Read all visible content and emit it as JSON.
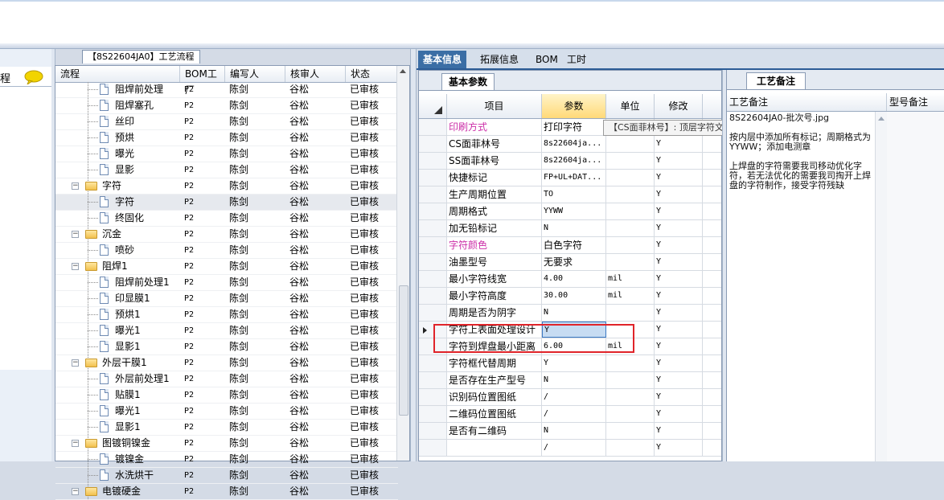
{
  "left_panel": {
    "label": "程",
    "chat_icon": "speech-bubble-icon"
  },
  "process": {
    "title": "【8S22604JA0】工艺流程",
    "columns": [
      "流程",
      "BOM工厂",
      "编写人",
      "核审人",
      "状态"
    ],
    "rows": [
      {
        "name": "阻焊前处理",
        "bom": "P2",
        "writer": "陈剑",
        "reviewer": "谷松",
        "status": "已审核",
        "level": 2,
        "kind": "doc"
      },
      {
        "name": "阻焊塞孔",
        "bom": "P2",
        "writer": "陈剑",
        "reviewer": "谷松",
        "status": "已审核",
        "level": 2,
        "kind": "doc"
      },
      {
        "name": "丝印",
        "bom": "P2",
        "writer": "陈剑",
        "reviewer": "谷松",
        "status": "已审核",
        "level": 2,
        "kind": "doc"
      },
      {
        "name": "预烘",
        "bom": "P2",
        "writer": "陈剑",
        "reviewer": "谷松",
        "status": "已审核",
        "level": 2,
        "kind": "doc"
      },
      {
        "name": "曝光",
        "bom": "P2",
        "writer": "陈剑",
        "reviewer": "谷松",
        "status": "已审核",
        "level": 2,
        "kind": "doc"
      },
      {
        "name": "显影",
        "bom": "P2",
        "writer": "陈剑",
        "reviewer": "谷松",
        "status": "已审核",
        "level": 2,
        "kind": "doc"
      },
      {
        "name": "字符",
        "bom": "P2",
        "writer": "陈剑",
        "reviewer": "谷松",
        "status": "已审核",
        "level": 1,
        "kind": "folder"
      },
      {
        "name": "字符",
        "bom": "P2",
        "writer": "陈剑",
        "reviewer": "谷松",
        "status": "已审核",
        "level": 2,
        "kind": "doc",
        "selected": true
      },
      {
        "name": "终固化",
        "bom": "P2",
        "writer": "陈剑",
        "reviewer": "谷松",
        "status": "已审核",
        "level": 2,
        "kind": "doc"
      },
      {
        "name": "沉金",
        "bom": "P2",
        "writer": "陈剑",
        "reviewer": "谷松",
        "status": "已审核",
        "level": 1,
        "kind": "folder"
      },
      {
        "name": "喷砂",
        "bom": "P2",
        "writer": "陈剑",
        "reviewer": "谷松",
        "status": "已审核",
        "level": 2,
        "kind": "doc"
      },
      {
        "name": "阻焊1",
        "bom": "P2",
        "writer": "陈剑",
        "reviewer": "谷松",
        "status": "已审核",
        "level": 1,
        "kind": "folder"
      },
      {
        "name": "阻焊前处理1",
        "bom": "P2",
        "writer": "陈剑",
        "reviewer": "谷松",
        "status": "已审核",
        "level": 2,
        "kind": "doc"
      },
      {
        "name": "印显膜1",
        "bom": "P2",
        "writer": "陈剑",
        "reviewer": "谷松",
        "status": "已审核",
        "level": 2,
        "kind": "doc"
      },
      {
        "name": "预烘1",
        "bom": "P2",
        "writer": "陈剑",
        "reviewer": "谷松",
        "status": "已审核",
        "level": 2,
        "kind": "doc"
      },
      {
        "name": "曝光1",
        "bom": "P2",
        "writer": "陈剑",
        "reviewer": "谷松",
        "status": "已审核",
        "level": 2,
        "kind": "doc"
      },
      {
        "name": "显影1",
        "bom": "P2",
        "writer": "陈剑",
        "reviewer": "谷松",
        "status": "已审核",
        "level": 2,
        "kind": "doc"
      },
      {
        "name": "外层干膜1",
        "bom": "P2",
        "writer": "陈剑",
        "reviewer": "谷松",
        "status": "已审核",
        "level": 1,
        "kind": "folder"
      },
      {
        "name": "外层前处理1",
        "bom": "P2",
        "writer": "陈剑",
        "reviewer": "谷松",
        "status": "已审核",
        "level": 2,
        "kind": "doc"
      },
      {
        "name": "贴膜1",
        "bom": "P2",
        "writer": "陈剑",
        "reviewer": "谷松",
        "status": "已审核",
        "level": 2,
        "kind": "doc"
      },
      {
        "name": "曝光1",
        "bom": "P2",
        "writer": "陈剑",
        "reviewer": "谷松",
        "status": "已审核",
        "level": 2,
        "kind": "doc"
      },
      {
        "name": "显影1",
        "bom": "P2",
        "writer": "陈剑",
        "reviewer": "谷松",
        "status": "已审核",
        "level": 2,
        "kind": "doc"
      },
      {
        "name": "图镀铜镍金",
        "bom": "P2",
        "writer": "陈剑",
        "reviewer": "谷松",
        "status": "已审核",
        "level": 1,
        "kind": "folder"
      },
      {
        "name": "镀镍金",
        "bom": "P2",
        "writer": "陈剑",
        "reviewer": "谷松",
        "status": "已审核",
        "level": 2,
        "kind": "doc"
      },
      {
        "name": "水洗烘干",
        "bom": "P2",
        "writer": "陈剑",
        "reviewer": "谷松",
        "status": "已审核",
        "level": 2,
        "kind": "doc"
      },
      {
        "name": "电镀硬金",
        "bom": "P2",
        "writer": "陈剑",
        "reviewer": "谷松",
        "status": "已审核",
        "level": 1,
        "kind": "folder"
      }
    ]
  },
  "tabs": [
    {
      "label": "基本信息",
      "active": true
    },
    {
      "label": "拓展信息",
      "active": false
    },
    {
      "label": "BOM",
      "active": false
    },
    {
      "label": "工时",
      "active": false
    }
  ],
  "params": {
    "tab_label": "基本参数",
    "columns": [
      "项目",
      "参数",
      "单位",
      "修改"
    ],
    "tooltip": "【CS面菲林号】: 顶层字符文件名",
    "rows": [
      {
        "item": "印刷方式",
        "value": "打印字符",
        "unit": "",
        "mod": "",
        "pink": true
      },
      {
        "item": "CS面菲林号",
        "value": "8s22604ja...",
        "unit": "",
        "mod": "Y",
        "mono": true
      },
      {
        "item": "SS面菲林号",
        "value": "8s22604ja...",
        "unit": "",
        "mod": "Y",
        "mono": true
      },
      {
        "item": "快捷标记",
        "value": "FP+UL+DAT...",
        "unit": "",
        "mod": "Y",
        "mono": true
      },
      {
        "item": "生产周期位置",
        "value": "TO",
        "unit": "",
        "mod": "Y",
        "mono": true
      },
      {
        "item": "周期格式",
        "value": "YYWW",
        "unit": "",
        "mod": "Y",
        "mono": true
      },
      {
        "item": "加无铅标记",
        "value": "N",
        "unit": "",
        "mod": "Y",
        "mono": true
      },
      {
        "item": "字符颜色",
        "value": "白色字符",
        "unit": "",
        "mod": "Y",
        "pink": true
      },
      {
        "item": "油墨型号",
        "value": "无要求",
        "unit": "",
        "mod": "Y"
      },
      {
        "item": "最小字符线宽",
        "value": "4.00",
        "unit": "mil",
        "mod": "Y",
        "mono": true
      },
      {
        "item": "最小字符高度",
        "value": "30.00",
        "unit": "mil",
        "mod": "Y",
        "mono": true
      },
      {
        "item": "周期是否为阴字",
        "value": "N",
        "unit": "",
        "mod": "Y",
        "mono": true
      },
      {
        "item": "字符上表面处理设计",
        "value": "Y",
        "unit": "",
        "mod": "Y",
        "mono": true,
        "current": true
      },
      {
        "item": "字符到焊盘最小距离",
        "value": "6.00",
        "unit": "mil",
        "mod": "Y",
        "mono": true
      },
      {
        "item": "字符框代替周期",
        "value": "Y",
        "unit": "",
        "mod": "Y",
        "mono": true
      },
      {
        "item": "是否存在生产型号",
        "value": "N",
        "unit": "",
        "mod": "Y",
        "mono": true
      },
      {
        "item": "识别码位置图纸",
        "value": "/",
        "unit": "",
        "mod": "Y",
        "mono": true
      },
      {
        "item": "二维码位置图纸",
        "value": "/",
        "unit": "",
        "mod": "Y",
        "mono": true
      },
      {
        "item": "是否有二维码",
        "value": "N",
        "unit": "",
        "mod": "Y",
        "mono": true
      },
      {
        "item": "",
        "value": "/",
        "unit": "",
        "mod": "Y",
        "mono": true
      }
    ]
  },
  "notes": {
    "tab_label": "工艺备注",
    "columns": [
      "工艺备注",
      "型号备注"
    ],
    "paragraphs": [
      "8S22604JA0-批次号.jpg",
      "按内层中添加所有标记；周期格式为YYWW；添加电测章",
      "上焊盘的字符需要我司移动优化字符，若无法优化的需要我司掏开上焊盘的字符制作，接受字符残缺"
    ]
  },
  "colors": {
    "tab_active": "#3b6ea5",
    "pink_item": "#cc2fa8",
    "highlight_box": "#e0242a",
    "param_header": "#ffd978"
  }
}
